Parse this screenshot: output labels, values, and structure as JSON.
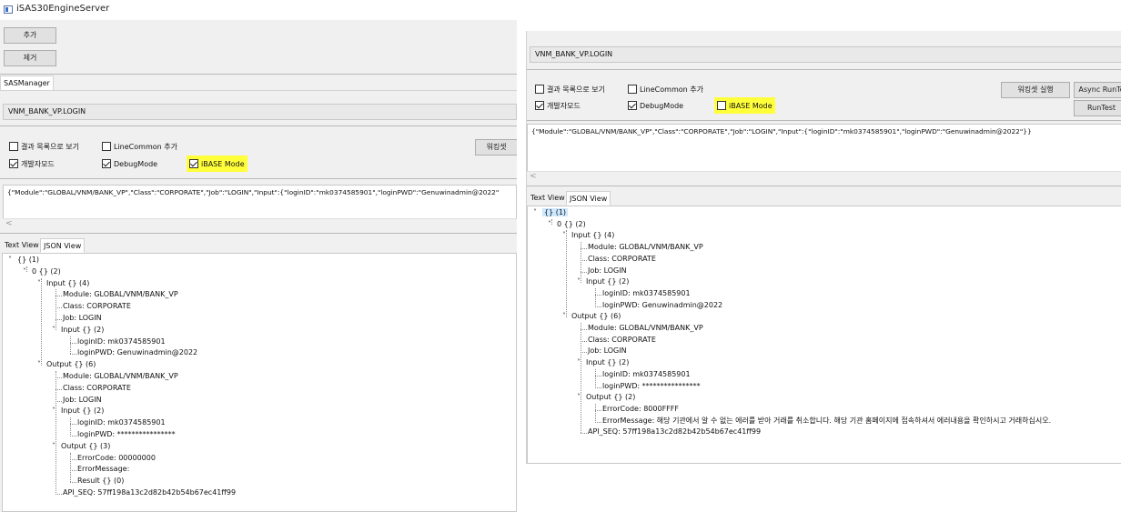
{
  "app": {
    "title": "iSAS30EngineServer"
  },
  "left": {
    "add_label": "추가",
    "remove_label": "제거",
    "manager_tab": "SASManager",
    "service_name": "VNM_BANK_VP.LOGIN",
    "options": {
      "result_list": "결과 목록으로 보기",
      "linecommon": "LineCommon 추가",
      "devmode": "개발자모드",
      "debugmode": "DebugMode",
      "ibase": "iBASE Mode"
    },
    "workset_label": "워킹셋",
    "json_text": "{\"Module\":\"GLOBAL/VNM/BANK_VP\",\"Class\":\"CORPORATE\",\"Job\":\"LOGIN\",\"Input\":{\"loginID\":\"mk0374585901\",\"loginPWD\":\"Genuwinadmin@2022\"",
    "scroll_arrow": "<",
    "tabs": {
      "text": "Text View",
      "json": "JSON View"
    },
    "tree": [
      "{} (1)",
      "0 {} (2)",
      "Input {} (4)",
      "Module: GLOBAL/VNM/BANK_VP",
      "Class: CORPORATE",
      "Job: LOGIN",
      "Input {} (2)",
      "loginID: mk0374585901",
      "loginPWD: Genuwinadmin@2022",
      "Output {} (6)",
      "Module: GLOBAL/VNM/BANK_VP",
      "Class: CORPORATE",
      "Job: LOGIN",
      "Input {} (2)",
      "loginID: mk0374585901",
      "loginPWD: ****************",
      "Output {} (3)",
      "ErrorCode: 00000000",
      "ErrorMessage:",
      "Result {} (0)",
      "API_SEQ: 57ff198a13c2d82b42b54b67ec41ff99"
    ]
  },
  "right": {
    "service_name": "VNM_BANK_VP.LOGIN",
    "options": {
      "result_list": "결과 목록으로 보기",
      "linecommon": "LineCommon 추가",
      "devmode": "개발자모드",
      "debugmode": "DebugMode",
      "ibase": "iBASE Mode"
    },
    "workset_run": "워킹셋 실행",
    "async_run": "Async RunTe",
    "run_test": "RunTest",
    "json_text": "{\"Module\":\"GLOBAL/VNM/BANK_VP\",\"Class\":\"CORPORATE\",\"Job\":\"LOGIN\",\"Input\":{\"loginID\":\"mk0374585901\",\"loginPWD\":\"Genuwinadmin@2022\"}}",
    "scroll_arrow": "<",
    "tabs": {
      "text": "Text View",
      "json": "JSON View"
    },
    "tree": [
      "{} (1)",
      "0 {} (2)",
      "Input {} (4)",
      "Module: GLOBAL/VNM/BANK_VP",
      "Class: CORPORATE",
      "Job: LOGIN",
      "Input {} (2)",
      "loginID: mk0374585901",
      "loginPWD: Genuwinadmin@2022",
      "Output {} (6)",
      "Module: GLOBAL/VNM/BANK_VP",
      "Class: CORPORATE",
      "Job: LOGIN",
      "Input {} (2)",
      "loginID: mk0374585901",
      "loginPWD: ****************",
      "Output {} (2)",
      "ErrorCode: 8000FFFF",
      "ErrorMessage: 해당 기관에서 알 수 없는 에러를 받아 거래를 취소합니다. 해당 기관 홈페이지에 접속하셔서 에러내용을 확인하시고 거래하십시오.",
      "API_SEQ: 57ff198a13c2d82b42b54b67ec41ff99"
    ]
  },
  "colors": {
    "highlight": "#ffff3a",
    "selection": "#cce8ff"
  }
}
